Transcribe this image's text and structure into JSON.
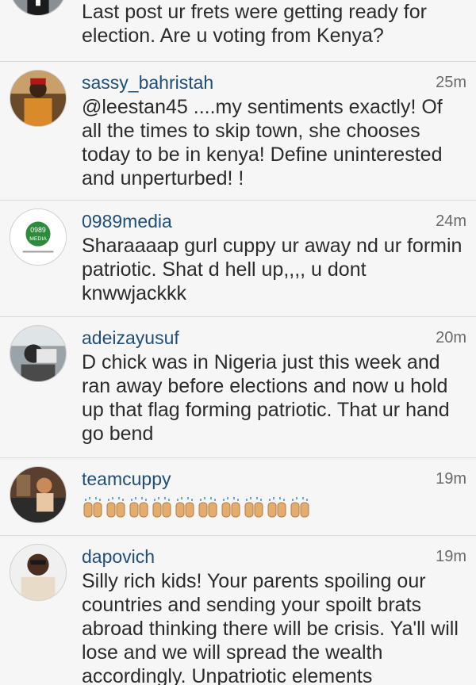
{
  "comments": [
    {
      "user": "",
      "time": "",
      "text": "Last post ur frets were getting ready for election. Are u voting from Kenya?",
      "avatar_icon": "profile-photo"
    },
    {
      "user": "sassy_bahristah",
      "time": "25m",
      "text": "@leestan45 ....my sentiments exactly! Of all the times to skip town, she chooses today to be in kenya! Define uninterested and unperturbed! !",
      "avatar_icon": "profile-photo"
    },
    {
      "user": "0989media",
      "time": "24m",
      "text": "Sharaaaap gurl cuppy ur away nd ur formin patriotic. Shat d hell up,,,, u dont knwwjackkk",
      "avatar_icon": "media-logo"
    },
    {
      "user": "adeizayusuf",
      "time": "20m",
      "text": "D chick was in Nigeria just this week and ran away before elections and now u hold up that flag forming patriotic. That ur hand go bend",
      "avatar_icon": "profile-photo"
    },
    {
      "user": "teamcuppy",
      "time": "19m",
      "text": "",
      "emoji": [
        "🙌",
        "🙌",
        "🙌",
        "🙌",
        "🙌",
        "🙌",
        "🙌",
        "🙌",
        "🙌",
        "🙌"
      ],
      "avatar_icon": "profile-photo"
    },
    {
      "user": "dapovich",
      "time": "19m",
      "text": "Silly rich kids! Your parents spoiling our countries and sending your spoilt brats abroad thinking there will be crisis. Ya'll will lose and we will spread the wealth accordingly. Unpatriotic elements",
      "avatar_icon": "profile-photo"
    }
  ],
  "colors": {
    "username": "#1f4e78",
    "text": "#2b2b2b",
    "time": "#6a6a6a",
    "background": "#f6f6f6"
  }
}
